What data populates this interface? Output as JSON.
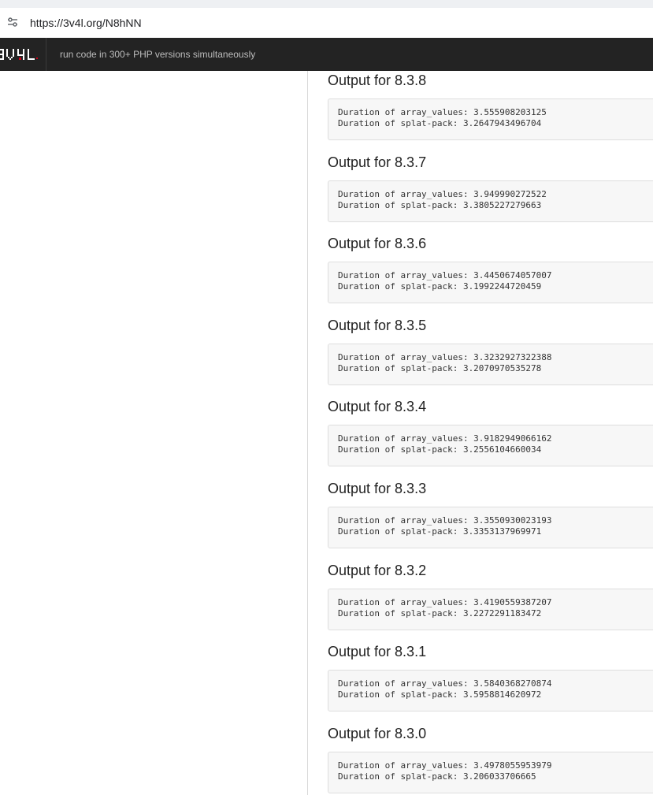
{
  "browser": {
    "url": "https://3v4l.org/N8hNN"
  },
  "header": {
    "logo_text": "3V4L",
    "tagline": "run code in 300+ PHP versions simultaneously"
  },
  "outputs": [
    {
      "heading": "Output for 8.3.8",
      "lines": [
        "Duration of array_values: 3.555908203125",
        "Duration of splat-pack: 3.2647943496704"
      ]
    },
    {
      "heading": "Output for 8.3.7",
      "lines": [
        "Duration of array_values: 3.949990272522",
        "Duration of splat-pack: 3.3805227279663"
      ]
    },
    {
      "heading": "Output for 8.3.6",
      "lines": [
        "Duration of array_values: 3.4450674057007",
        "Duration of splat-pack: 3.1992244720459"
      ]
    },
    {
      "heading": "Output for 8.3.5",
      "lines": [
        "Duration of array_values: 3.3232927322388",
        "Duration of splat-pack: 3.2070970535278"
      ]
    },
    {
      "heading": "Output for 8.3.4",
      "lines": [
        "Duration of array_values: 3.9182949066162",
        "Duration of splat-pack: 3.2556104660034"
      ]
    },
    {
      "heading": "Output for 8.3.3",
      "lines": [
        "Duration of array_values: 3.3550930023193",
        "Duration of splat-pack: 3.3353137969971"
      ]
    },
    {
      "heading": "Output for 8.3.2",
      "lines": [
        "Duration of array_values: 3.4190559387207",
        "Duration of splat-pack: 3.2272291183472"
      ]
    },
    {
      "heading": "Output for 8.3.1",
      "lines": [
        "Duration of array_values: 3.5840368270874",
        "Duration of splat-pack: 3.5958814620972"
      ]
    },
    {
      "heading": "Output for 8.3.0",
      "lines": [
        "Duration of array_values: 3.4978055953979",
        "Duration of splat-pack: 3.206033706665"
      ]
    }
  ]
}
